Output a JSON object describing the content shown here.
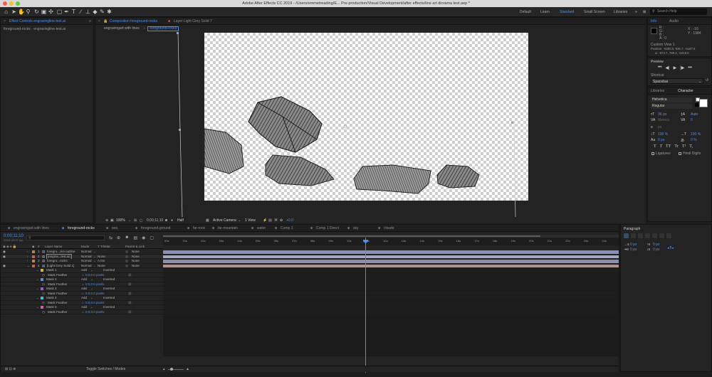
{
  "window": {
    "title": "Adobe After Effects CC 2019 - /Users/emmetreading/E... Pre-production/Visual Development/after effects/line art diorama test.aep *"
  },
  "workspaces": [
    {
      "label": "Default"
    },
    {
      "label": "Learn"
    },
    {
      "label": "Standard"
    },
    {
      "label": "Small Screen"
    },
    {
      "label": "Libraries"
    }
  ],
  "search": {
    "placeholder": "Search Help"
  },
  "effect_controls": {
    "tab": "Effect Controls engravingline-test.ai",
    "subtitle": "foreground-rocks · engravingline-test.ai"
  },
  "composition": {
    "tab": "Composition foreground-rocks",
    "layer_tab": "Layer Light Grey Solid 7",
    "breadcrumbs": [
      "engravingart with lines",
      "foreground-rocks"
    ]
  },
  "viewer_bar": {
    "zoom": "100%",
    "timecode": "0;00;11;10",
    "resolution": "Half",
    "camera": "Active Camera",
    "views": "1 View",
    "exposure": "+0.0"
  },
  "info_panel": {
    "tabs": [
      "Info",
      "Audio"
    ],
    "r": "R :",
    "g": "G :",
    "b": "B :",
    "a": "A : 0",
    "x": "X : -16",
    "y": "Y : 1984",
    "view": "Custom View 1",
    "position": "Position: -6250.0, 935.7, -5187.6",
    "orientation": "Δ: -874.7, 799.4, -6319.0"
  },
  "preview": {
    "title": "Preview",
    "controls": [
      "⏮",
      "◀|",
      "▶",
      "|▶",
      "⏭"
    ]
  },
  "shortcut": {
    "label": "Shortcut",
    "value": "Spacebar"
  },
  "character": {
    "tabs": [
      "Libraries",
      "Character"
    ],
    "font": "Helvetica",
    "style": "Regular",
    "size": "36 px",
    "leading": "Auto",
    "kerning": "Metrics",
    "tracking": "0",
    "stroke": "px",
    "vscale": "100 %",
    "hscale": "100 %",
    "baseline": "0 px",
    "tsume": "0 %",
    "styles": [
      "T",
      "T",
      "TT",
      "Tr",
      "T¹",
      "T,"
    ],
    "ligatures": "Ligatures",
    "hindi": "Hindi Digits"
  },
  "paragraph": {
    "title": "Paragraph",
    "indent_left": "0 px",
    "indent_first": "0 px",
    "space_before": "0 px",
    "space_after": "0 px"
  },
  "timeline": {
    "tabs": [
      {
        "label": "engravingart with lines",
        "color": "#8c8c8c"
      },
      {
        "label": "foreground-rocks",
        "color": "#c8c8c8",
        "active": true
      },
      {
        "label": "sea",
        "color": "#8c8c8c"
      },
      {
        "label": "foreground-ground",
        "color": "#8c8c8c"
      },
      {
        "label": "far-rock",
        "color": "#8c8c8c"
      },
      {
        "label": "far-mountain",
        "color": "#8c8c8c"
      },
      {
        "label": "water",
        "color": "#8c8c8c"
      },
      {
        "label": "Comp 1",
        "color": "#8c8c8c"
      },
      {
        "label": "Comp 1 Direct",
        "color": "#8c8c8c"
      },
      {
        "label": "sky",
        "color": "#8c8c8c"
      },
      {
        "label": "clouds",
        "color": "#8c8c8c"
      }
    ],
    "timecode": "0;00;11;10",
    "fps": "00340 (29.97 fps)",
    "headers": {
      "layer_name": "Layer Name",
      "mode": "Mode",
      "trkmat": "T TrkMat",
      "parent": "Parent & Link"
    },
    "ruler": [
      "00s",
      "01s",
      "02s",
      "03s",
      "04s",
      "05s",
      "06s",
      "07s",
      "08s",
      "09s",
      "10s",
      "11s",
      "12s",
      "13s",
      "14s",
      "15s",
      "16s",
      "17s",
      "18s",
      "19s",
      "20s",
      "21s",
      "22s",
      "23s",
      "24s"
    ],
    "layers": [
      {
        "num": "1",
        "name": "foregro...cks-outline",
        "mode": "Normal",
        "trkmat": "",
        "parent": "None",
        "color": "#a78a5c"
      },
      {
        "num": "2",
        "name": "[engrav...test.ai]",
        "mode": "Normal",
        "trkmat": "None",
        "parent": "None",
        "color": "#c95a5a"
      },
      {
        "num": "3",
        "name": "foregro...rocks",
        "mode": "Normal",
        "trkmat": "A.Inv",
        "parent": "None",
        "color": "#a78a5c"
      },
      {
        "num": "4",
        "name": "[Light Grey Solid 1]",
        "mode": "Normal",
        "trkmat": "None",
        "parent": "None",
        "color": "#c95a5a"
      }
    ],
    "masks": [
      {
        "name": "Mask 1",
        "mode": "Add",
        "inverted": "Inverted",
        "feather_label": "Mask Feather",
        "feather": "0.0,0.0 pixels",
        "color": "#d4b24a"
      },
      {
        "name": "Mask 2",
        "mode": "Add",
        "inverted": "Inverted",
        "feather_label": "Mask Feather",
        "feather": "0.0,0.0 pixels",
        "color": "#5b8fd6"
      },
      {
        "name": "Mask 3",
        "mode": "Add",
        "inverted": "Inverted",
        "feather_label": "Mask Feather",
        "feather": "0.0,0.0 pixels",
        "color": "#9c5bd6"
      },
      {
        "name": "Mask 4",
        "mode": "Add",
        "inverted": "Inverted",
        "feather_label": "Mask Feather",
        "feather": "0.0,0.0 pixels",
        "color": "#5bb0d6"
      },
      {
        "name": "Mask 5",
        "mode": "Add",
        "inverted": "Inverted",
        "feather_label": "Mask Feather",
        "feather": "0.0,0.0 pixels",
        "color": "#d65bb0"
      }
    ],
    "toggle": "Toggle Switches / Modes"
  }
}
